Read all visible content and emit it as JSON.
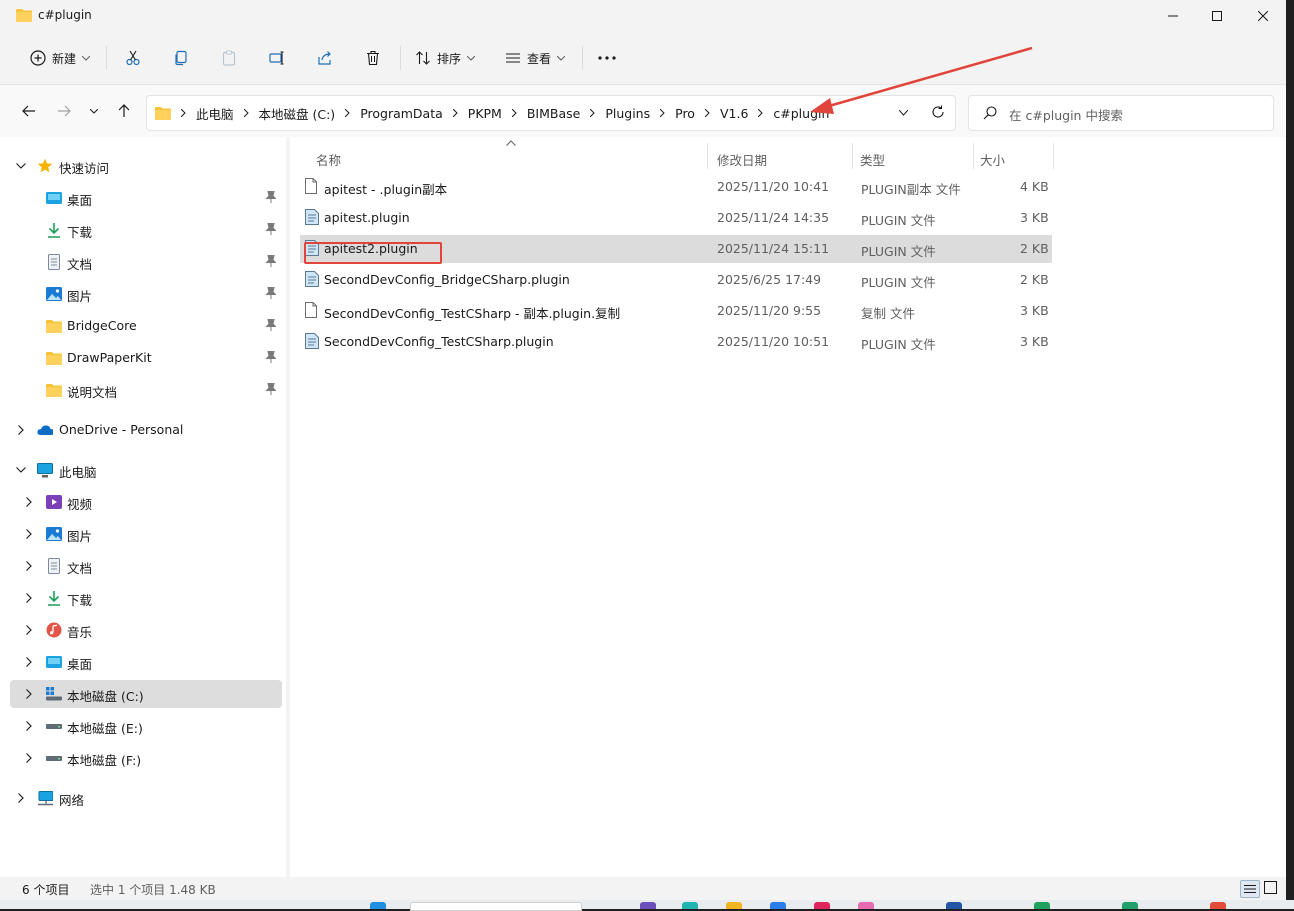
{
  "window": {
    "title": "c#plugin"
  },
  "toolbar": {
    "new_label": "新建",
    "sort_label": "排序",
    "view_label": "查看"
  },
  "breadcrumb": [
    "此电脑",
    "本地磁盘 (C:)",
    "ProgramData",
    "PKPM",
    "BIMBase",
    "Plugins",
    "Pro",
    "V1.6",
    "c#plugin"
  ],
  "search": {
    "placeholder": "在 c#plugin 中搜索"
  },
  "sidebar": {
    "quick_access": "快速访问",
    "pinned": [
      "桌面",
      "下载",
      "文档",
      "图片",
      "BridgeCore",
      "DrawPaperKit",
      "说明文档"
    ],
    "onedrive": "OneDrive - Personal",
    "this_pc": "此电脑",
    "pc_items": [
      "视频",
      "图片",
      "文档",
      "下载",
      "音乐",
      "桌面",
      "本地磁盘 (C:)",
      "本地磁盘 (E:)",
      "本地磁盘 (F:)"
    ],
    "network": "网络"
  },
  "columns": {
    "name": "名称",
    "modified": "修改日期",
    "type": "类型",
    "size": "大小"
  },
  "files": [
    {
      "name": "apitest - .plugin副本",
      "modified": "2025/11/20 10:41",
      "type": "PLUGIN副本 文件",
      "size": "4 KB"
    },
    {
      "name": "apitest.plugin",
      "modified": "2025/11/24 14:35",
      "type": "PLUGIN 文件",
      "size": "3 KB"
    },
    {
      "name": "apitest2.plugin",
      "modified": "2025/11/24 15:11",
      "type": "PLUGIN 文件",
      "size": "2 KB"
    },
    {
      "name": "SecondDevConfig_BridgeCSharp.plugin",
      "modified": "2025/6/25 17:49",
      "type": "PLUGIN 文件",
      "size": "2 KB"
    },
    {
      "name": "SecondDevConfig_TestCSharp - 副本.plugin.复制",
      "modified": "2025/11/20 9:55",
      "type": "复制 文件",
      "size": "3 KB"
    },
    {
      "name": "SecondDevConfig_TestCSharp.plugin",
      "modified": "2025/11/20 10:51",
      "type": "PLUGIN 文件",
      "size": "3 KB"
    }
  ],
  "status": {
    "count": "6 个项目",
    "selection": "选中 1 个项目  1.48 KB"
  },
  "colors": {
    "accent": "#0067c0",
    "annotation": "#e0443b",
    "selected_row": "#dcdcdc",
    "folder": "#f8c33a"
  }
}
